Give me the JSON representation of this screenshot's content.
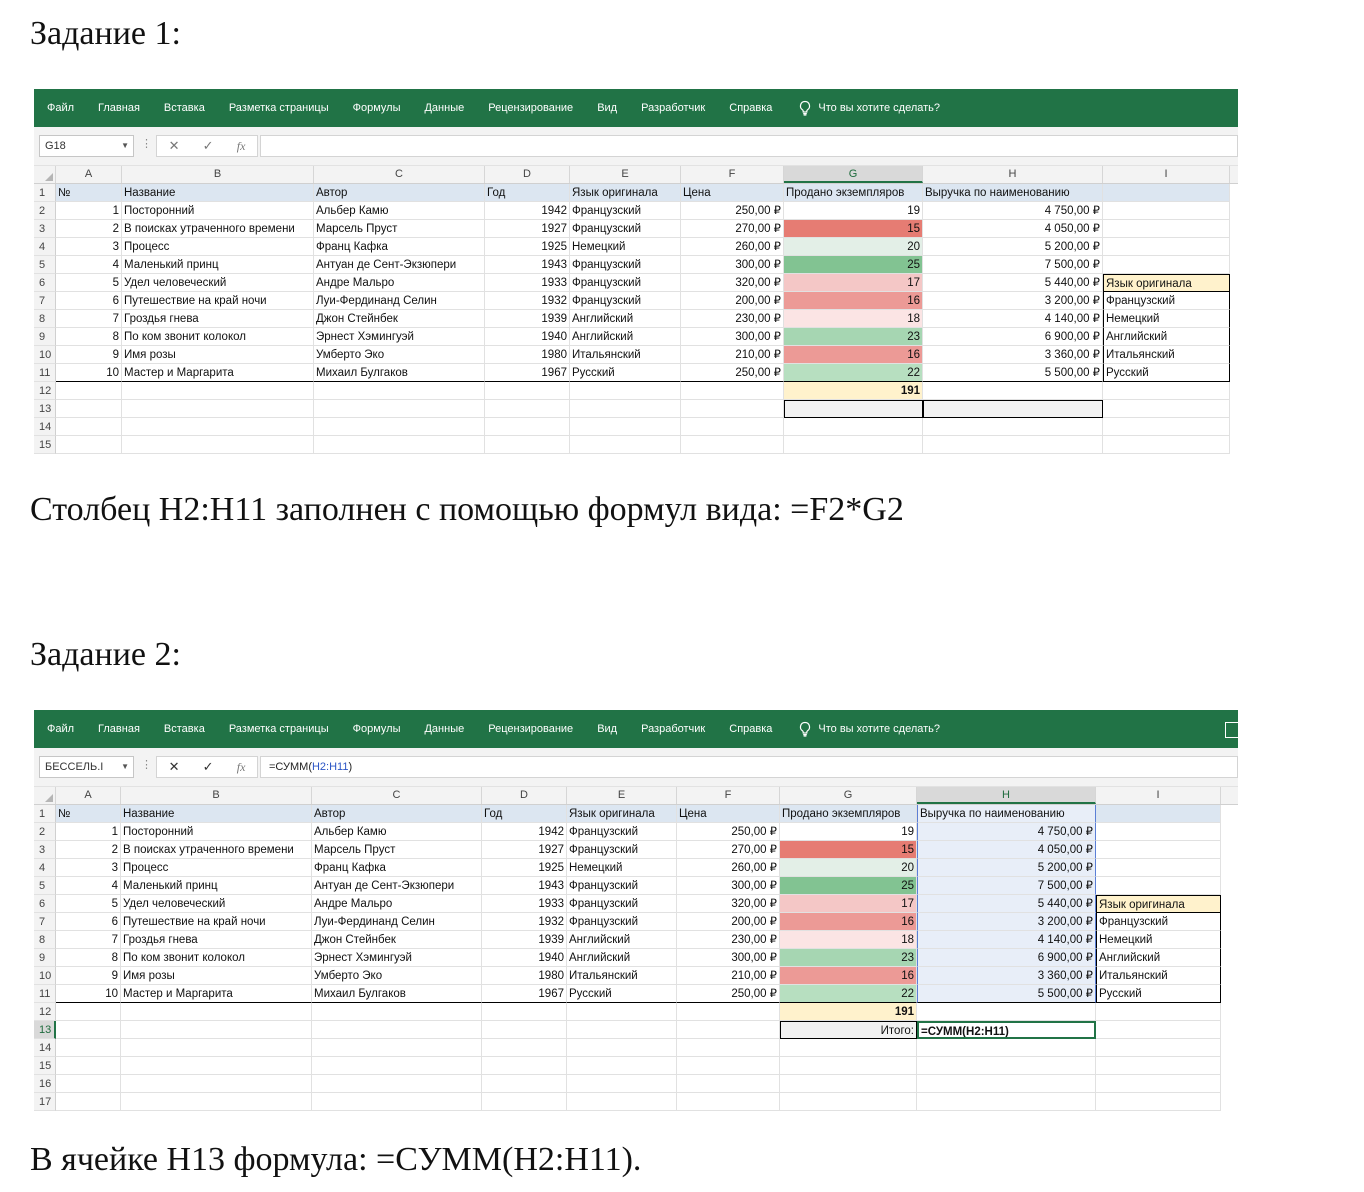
{
  "task1": {
    "heading": "Задание 1:",
    "caption": "Столбец H2:H11 заполнен с помощью формул вида: =F2*G2"
  },
  "task2": {
    "heading": "Задание 2:",
    "caption": "В ячейке H13 формула: =СУММ(H2:H11)."
  },
  "ribbon": {
    "tabs": [
      "Файл",
      "Главная",
      "Вставка",
      "Разметка страницы",
      "Формулы",
      "Данные",
      "Рецензирование",
      "Вид",
      "Разработчик",
      "Справка"
    ],
    "tell_me": "Что вы хотите сделать?"
  },
  "sheet1": {
    "namebox": "G18",
    "formula": "",
    "formula_ref": ""
  },
  "sheet2": {
    "namebox": "БЕССЕЛЬ.I",
    "formula": "=СУММ(",
    "formula_ref": "H2:H11",
    "formula_end": ")",
    "h13_label": "Итого:",
    "h13_formula": "=СУММ(H2:H11)"
  },
  "columns": [
    "A",
    "B",
    "C",
    "D",
    "E",
    "F",
    "G",
    "H",
    "I"
  ],
  "header_row": {
    "a": "№",
    "b": "Название",
    "c": "Автор",
    "d": "Год",
    "e": "Язык оригинала",
    "f": "Цена",
    "g": "Продано экземпляров",
    "h": "Выручка по наименованию"
  },
  "rows": [
    {
      "n": "1",
      "title": "Посторонний",
      "author": "Альбер Камю",
      "year": "1942",
      "lang": "Французский",
      "price": "250,00 ₽",
      "sold": "19",
      "revenue": "4 750,00 ₽",
      "i": ""
    },
    {
      "n": "2",
      "title": "В поисках утраченного времени",
      "author": "Марсель Пруст",
      "year": "1927",
      "lang": "Французский",
      "price": "270,00 ₽",
      "sold": "15",
      "revenue": "4 050,00 ₽",
      "i": ""
    },
    {
      "n": "3",
      "title": "Процесс",
      "author": "Франц Кафка",
      "year": "1925",
      "lang": "Немецкий",
      "price": "260,00 ₽",
      "sold": "20",
      "revenue": "5 200,00 ₽",
      "i": ""
    },
    {
      "n": "4",
      "title": "Маленький принц",
      "author": "Антуан де Сент-Экзюпери",
      "year": "1943",
      "lang": "Французский",
      "price": "300,00 ₽",
      "sold": "25",
      "revenue": "7 500,00 ₽",
      "i": ""
    },
    {
      "n": "5",
      "title": "Удел человеческий",
      "author": "Андре Мальро",
      "year": "1933",
      "lang": "Французский",
      "price": "320,00 ₽",
      "sold": "17",
      "revenue": "5 440,00 ₽",
      "i": "Язык оригинала"
    },
    {
      "n": "6",
      "title": "Путешествие на край ночи",
      "author": "Луи-Фердинанд Селин",
      "year": "1932",
      "lang": "Французский",
      "price": "200,00 ₽",
      "sold": "16",
      "revenue": "3 200,00 ₽",
      "i": "Французский"
    },
    {
      "n": "7",
      "title": "Гроздья гнева",
      "author": "Джон Стейнбек",
      "year": "1939",
      "lang": "Английский",
      "price": "230,00 ₽",
      "sold": "18",
      "revenue": "4 140,00 ₽",
      "i": "Немецкий"
    },
    {
      "n": "8",
      "title": "По ком звонит колокол",
      "author": "Эрнест Хэмингуэй",
      "year": "1940",
      "lang": "Английский",
      "price": "300,00 ₽",
      "sold": "23",
      "revenue": "6 900,00 ₽",
      "i": "Английский"
    },
    {
      "n": "9",
      "title": "Имя розы",
      "author": "Умберто Эко",
      "year": "1980",
      "lang": "Итальянский",
      "price": "210,00 ₽",
      "sold": "16",
      "revenue": "3 360,00 ₽",
      "i": "Итальянский"
    },
    {
      "n": "10",
      "title": "Мастер и Маргарита",
      "author": "Михаил Булгаков",
      "year": "1967",
      "lang": "Русский",
      "price": "250,00 ₽",
      "sold": "22",
      "revenue": "5 500,00 ₽",
      "i": "Русский"
    }
  ],
  "sold_colors": [
    "#ffffff",
    "#e67c73",
    "#e3efe7",
    "#82c392",
    "#f4c7c6",
    "#ec9a96",
    "#fbe4e4",
    "#a6d6b2",
    "#ec9a96",
    "#b7dfc0"
  ],
  "total_sold": "191",
  "row_numbers_1": [
    "1",
    "2",
    "3",
    "4",
    "5",
    "6",
    "7",
    "8",
    "9",
    "10",
    "11",
    "12",
    "13",
    "14",
    "15"
  ],
  "row_numbers_2": [
    "1",
    "2",
    "3",
    "4",
    "5",
    "6",
    "7",
    "8",
    "9",
    "10",
    "11",
    "12",
    "13",
    "14",
    "15",
    "16",
    "17"
  ]
}
